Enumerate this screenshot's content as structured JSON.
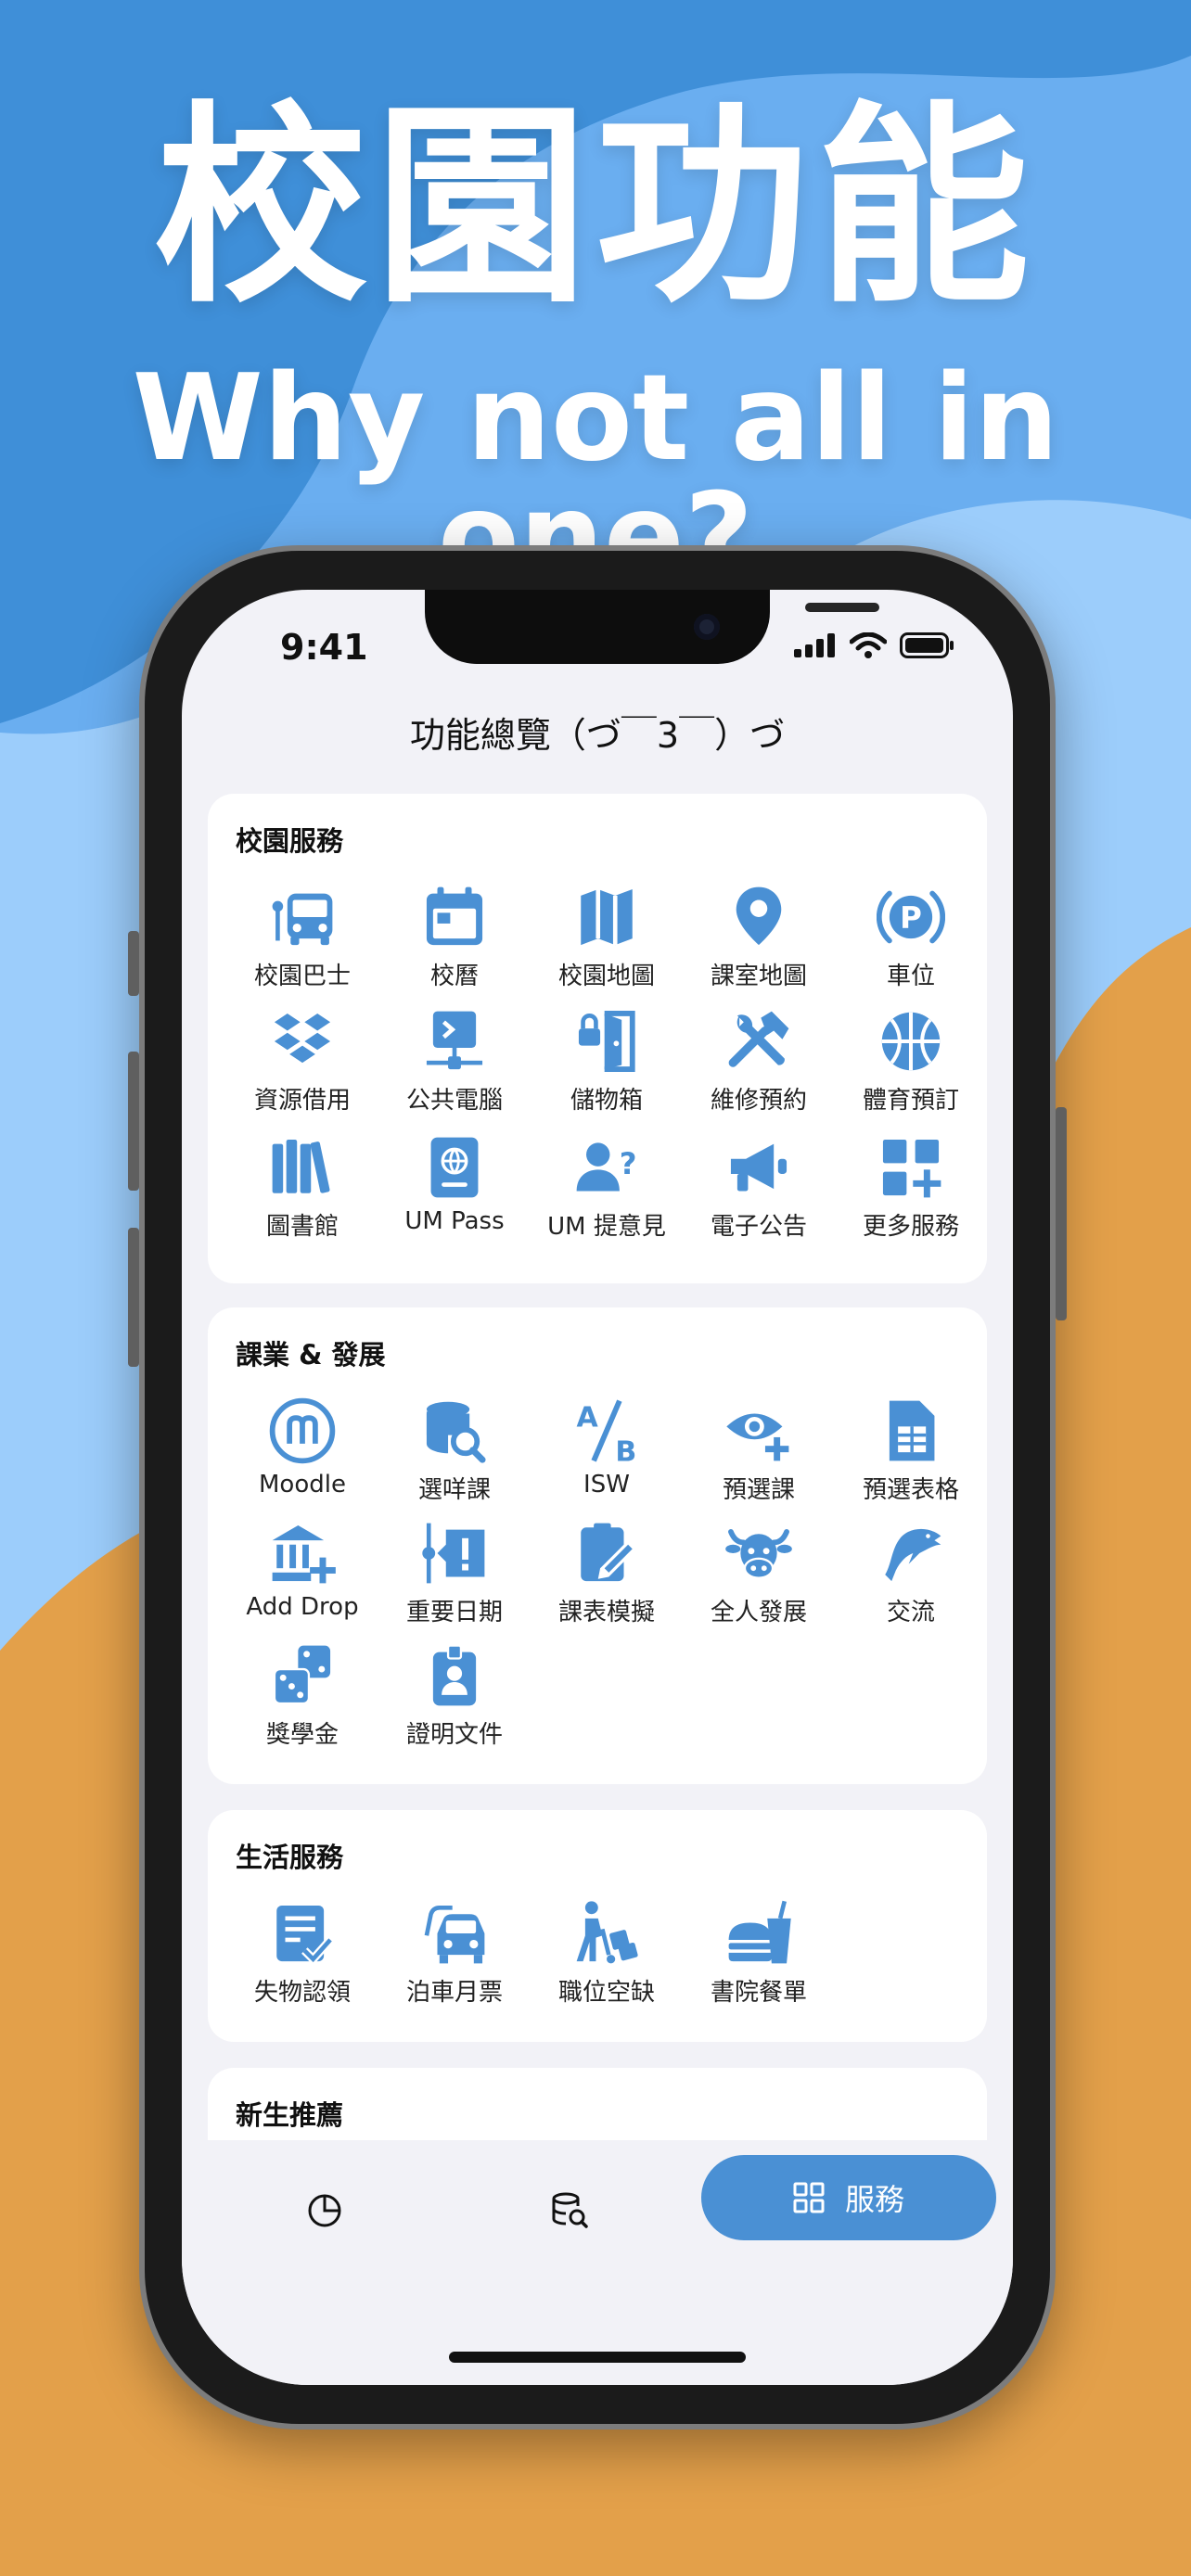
{
  "hero": {
    "title": "校園功能",
    "subtitle": "Why not all in one?"
  },
  "colors": {
    "accent": "#4a90d4",
    "orange": "#e3a04a",
    "sky": "#6aaef0"
  },
  "status": {
    "time": "9:41"
  },
  "nav": {
    "title": "功能總覽（づ￣3￣）づ"
  },
  "sections": [
    {
      "title": "校園服務",
      "items": [
        {
          "label": "校園巴士",
          "icon": "bus-icon"
        },
        {
          "label": "校曆",
          "icon": "calendar-icon"
        },
        {
          "label": "校園地圖",
          "icon": "map-icon"
        },
        {
          "label": "課室地圖",
          "icon": "location-pin-icon"
        },
        {
          "label": "車位",
          "icon": "parking-icon"
        },
        {
          "label": "資源借用",
          "icon": "dropbox-icon"
        },
        {
          "label": "公共電腦",
          "icon": "computer-network-icon"
        },
        {
          "label": "儲物箱",
          "icon": "locker-icon"
        },
        {
          "label": "維修預約",
          "icon": "tools-icon"
        },
        {
          "label": "體育預訂",
          "icon": "basketball-icon"
        },
        {
          "label": "圖書館",
          "icon": "library-icon"
        },
        {
          "label": "UM Pass",
          "icon": "passport-icon"
        },
        {
          "label": "UM 提意見",
          "icon": "user-question-icon"
        },
        {
          "label": "電子公告",
          "icon": "megaphone-icon"
        },
        {
          "label": "更多服務",
          "icon": "grid-plus-icon"
        }
      ]
    },
    {
      "title": "課業 & 發展",
      "items": [
        {
          "label": "Moodle",
          "icon": "moodle-icon"
        },
        {
          "label": "選咩課",
          "icon": "database-search-icon"
        },
        {
          "label": "ISW",
          "icon": "ab-icon"
        },
        {
          "label": "預選課",
          "icon": "eye-plus-icon"
        },
        {
          "label": "預選表格",
          "icon": "document-table-icon"
        },
        {
          "label": "Add Drop",
          "icon": "bank-plus-icon"
        },
        {
          "label": "重要日期",
          "icon": "timeline-alert-icon"
        },
        {
          "label": "課表模擬",
          "icon": "clipboard-edit-icon"
        },
        {
          "label": "全人發展",
          "icon": "cow-icon"
        },
        {
          "label": "交流",
          "icon": "dolphin-icon"
        },
        {
          "label": "獎學金",
          "icon": "dice-icon"
        },
        {
          "label": "證明文件",
          "icon": "badge-icon"
        }
      ]
    },
    {
      "title": "生活服務",
      "items": [
        {
          "label": "失物認領",
          "icon": "lost-found-icon"
        },
        {
          "label": "泊車月票",
          "icon": "car-icon"
        },
        {
          "label": "職位空缺",
          "icon": "worker-trolley-icon"
        },
        {
          "label": "書院餐單",
          "icon": "burger-drink-icon"
        }
      ]
    },
    {
      "title": "新生推薦",
      "items": []
    }
  ],
  "tabbar": {
    "services_label": "服務"
  }
}
